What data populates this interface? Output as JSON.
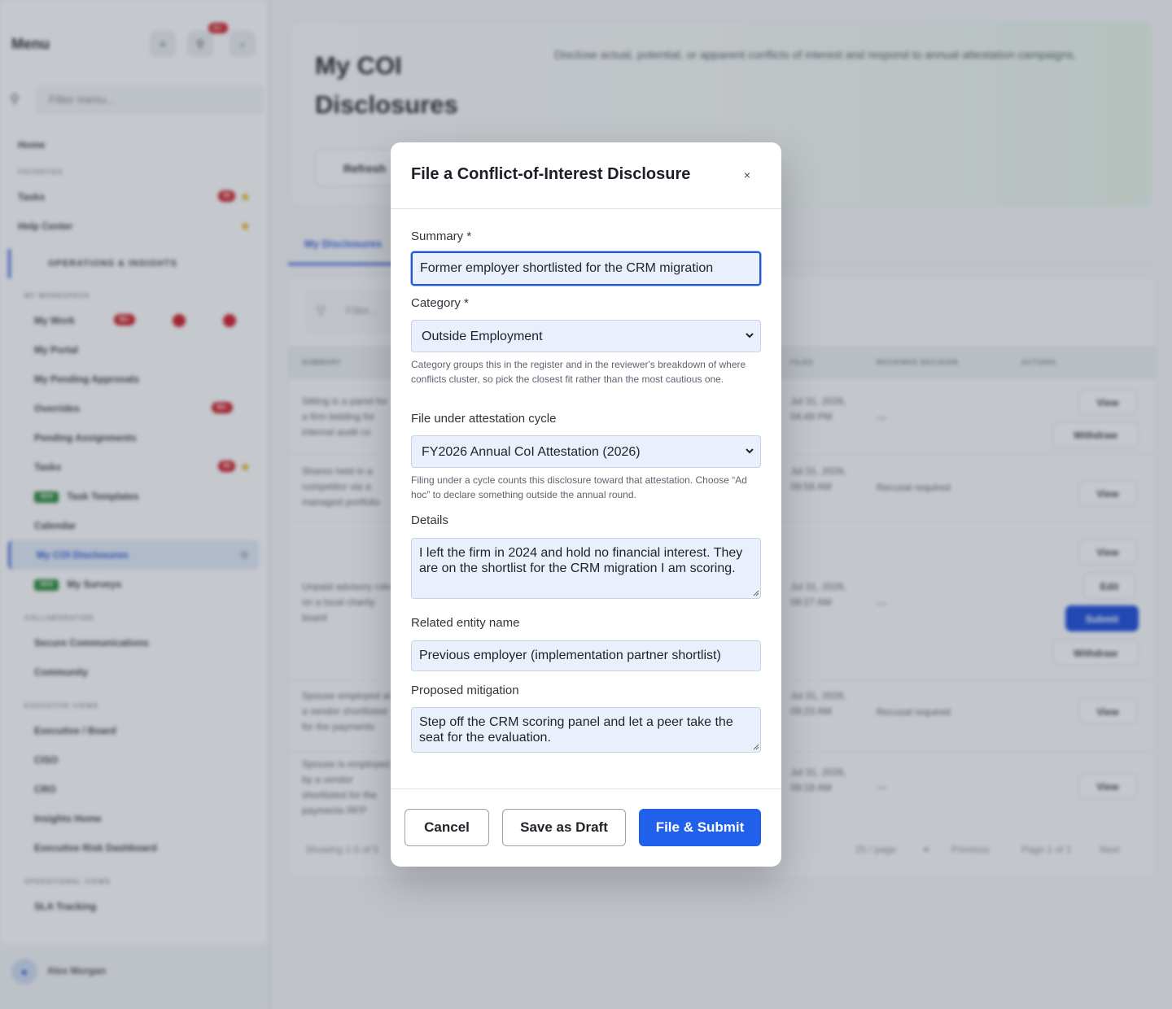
{
  "sidebar": {
    "title": "Menu",
    "notif_count": "99+",
    "filter_placeholder": "Filter menu...",
    "home": "Home",
    "section_favorites": "FAVORITES",
    "fav_tasks": "Tasks",
    "fav_tasks_count": "99",
    "fav_help": "Help Center",
    "group": "OPERATIONS & INSIGHTS",
    "section_workspace": "MY WORKSPACE",
    "my_work": "My Work",
    "my_work_count": "99+",
    "my_portal": "My Portal",
    "pending_approvals": "My Pending Approvals",
    "overrides": "Overrides",
    "overrides_count": "99+",
    "pending_assignments": "Pending Assignments",
    "tasks": "Tasks",
    "tasks_count": "99",
    "new_badge": "NEW",
    "task_templates": "Task Templates",
    "calendar": "Calendar",
    "coi": "My COI Disclosures",
    "surveys": "My Surveys",
    "section_collab": "COLLABORATION",
    "secure_comms": "Secure Communications",
    "community": "Community",
    "section_exec": "EXECUTIVE VIEWS",
    "exec_board": "Executive / Board",
    "ciso": "CISO",
    "cro": "CRO",
    "insights_home": "Insights Home",
    "exec_risk": "Executive Risk Dashboard",
    "section_ops": "OPERATIONAL VIEWS",
    "sla": "SLA Tracking",
    "user_name": "Alex Morgan"
  },
  "page": {
    "title": "My COI Disclosures",
    "description": "Disclose actual, potential, or apparent conflicts of interest and respond to annual attestation campaigns.",
    "refresh": "Refresh",
    "tab": "My Disclosures",
    "filter_placeholder": "Filter...",
    "col_summary": "SUMMARY",
    "col_filed": "FILED",
    "col_decision": "REVIEWER DECISION",
    "col_actions": "ACTIONS",
    "rows": [
      {
        "summary": "Sitting is a panel for a firm bidding for internal audit co",
        "filed": "Jul 31, 2026, 04:49 PM",
        "decision": "—"
      },
      {
        "summary": "Shares held in a competitor via a managed portfolio",
        "filed": "Jul 31, 2026, 09:58 AM",
        "decision": "Recusal required"
      },
      {
        "summary": "Unpaid advisory role on a local charity board",
        "filed": "Jul 31, 2026, 09:27 AM",
        "decision": "—"
      },
      {
        "summary": "Spouse employed at a vendor shortlisted for the payments",
        "filed": "Jul 31, 2026, 09:23 AM",
        "decision": "Recusal required"
      },
      {
        "summary": "Spouse is employed by a vendor shortlisted for the payments RFP",
        "filed": "Jul 31, 2026, 09:18 AM",
        "decision": "—"
      }
    ],
    "btn_view": "View",
    "btn_withdraw": "Withdraw",
    "btn_edit": "Edit",
    "btn_submit": "Submit",
    "showing": "Showing 1-5 of 5",
    "per_page": "25 / page",
    "previous": "Previous",
    "page_of": "Page 1 of 1",
    "next": "Next"
  },
  "modal": {
    "title": "File a Conflict-of-Interest Disclosure",
    "close": "×",
    "summary_label": "Summary *",
    "summary_value": "Former employer shortlisted for the CRM migration",
    "category_label": "Category *",
    "category_value": "Outside Employment",
    "category_help": "Category groups this in the register and in the reviewer's breakdown of where conflicts cluster, so pick the closest fit rather than the most cautious one.",
    "cycle_label": "File under attestation cycle",
    "cycle_value": "FY2026 Annual CoI Attestation (2026)",
    "cycle_help": "Filing under a cycle counts this disclosure toward that attestation. Choose “Ad hoc” to declare something outside the annual round.",
    "details_label": "Details",
    "details_value": "I left the firm in 2024 and hold no financial interest. They are on the shortlist for the CRM migration I am scoring.",
    "entity_label": "Related entity name",
    "entity_value": "Previous employer (implementation partner shortlist)",
    "mitigation_label": "Proposed mitigation",
    "mitigation_value": "Step off the CRM scoring panel and let a peer take the seat for the evaluation.",
    "cancel": "Cancel",
    "save_draft": "Save as Draft",
    "submit": "File & Submit"
  }
}
